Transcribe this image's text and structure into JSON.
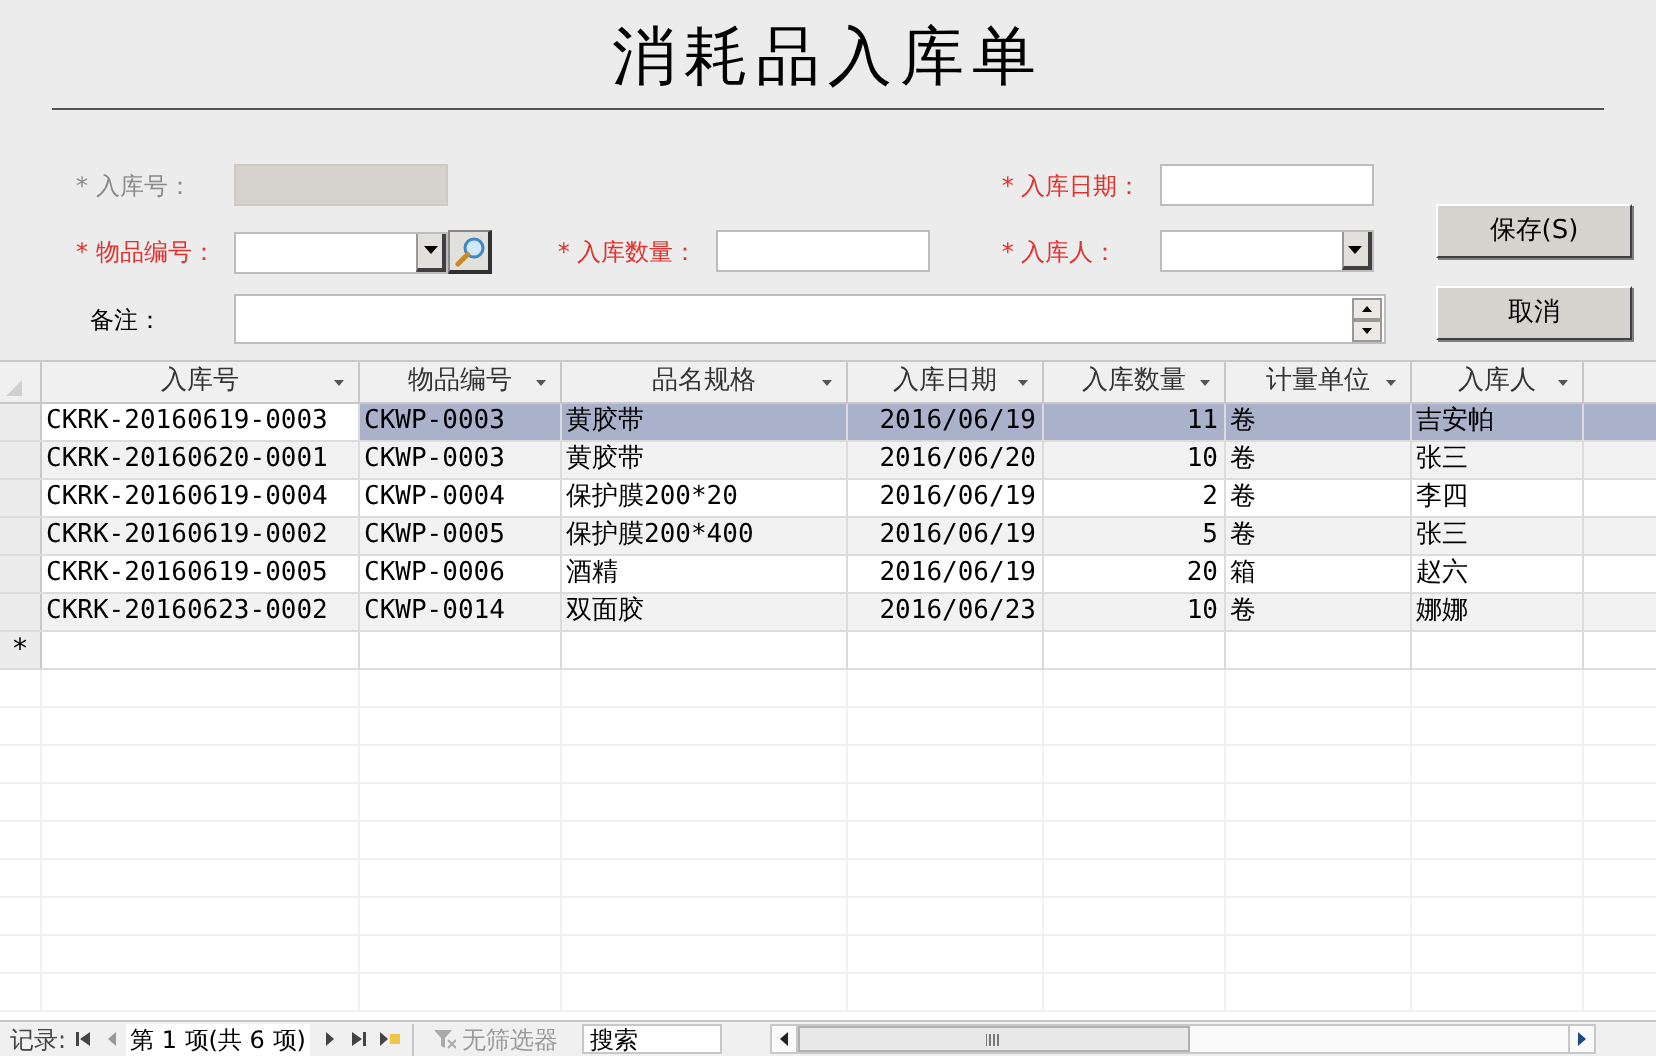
{
  "title": "消耗品入库单",
  "form": {
    "rows": [
      [
        {
          "label": "* 入库号：",
          "kind": "text",
          "disabled": true
        },
        "",
        {
          "label": "* 入库日期：",
          "kind": "text",
          "required": true,
          "disabled": false
        }
      ],
      [
        {
          "label": "* 物品编号：",
          "kind": "lookup",
          "required": true,
          "disabled": false
        },
        {
          "label": "* 入库数量：",
          "kind": "text",
          "required": true,
          "disabled": false
        },
        {
          "label": "* 入库人：",
          "kind": "combo",
          "required": true,
          "disabled": false
        }
      ],
      [
        {
          "label": "备注：",
          "kind": "memo",
          "required": false,
          "disabled": false
        }
      ]
    ]
  },
  "buttons": [
    "保存(S)",
    "取消"
  ],
  "table": {
    "columns": [
      {
        "label": "入库号",
        "kind": "text"
      },
      {
        "label": "物品编号",
        "kind": "text"
      },
      {
        "label": "品名规格",
        "kind": "text"
      },
      {
        "label": "入库日期",
        "kind": "number"
      },
      {
        "label": "入库数量",
        "kind": "number"
      },
      {
        "label": "计量单位",
        "kind": "text"
      },
      {
        "label": "入库人",
        "kind": "text"
      }
    ],
    "rows": [
      {
        "selected": true,
        "cells": [
          "CKRK-20160619-0003",
          "CKWP-0003",
          "黄胶带",
          "2016/06/19",
          "11",
          "卷",
          "吉安帕"
        ]
      },
      {
        "selected": false,
        "cells": [
          "CKRK-20160620-0001",
          "CKWP-0003",
          "黄胶带",
          "2016/06/20",
          "10",
          "卷",
          "张三"
        ]
      },
      {
        "selected": false,
        "cells": [
          "CKRK-20160619-0004",
          "CKWP-0004",
          "保护膜200*20",
          "2016/06/19",
          "2",
          "卷",
          "李四"
        ]
      },
      {
        "selected": false,
        "cells": [
          "CKRK-20160619-0002",
          "CKWP-0005",
          "保护膜200*400",
          "2016/06/19",
          "5",
          "卷",
          "张三"
        ]
      },
      {
        "selected": false,
        "cells": [
          "CKRK-20160619-0005",
          "CKWP-0006",
          "酒精",
          "2016/06/19",
          "20",
          "箱",
          "赵六"
        ]
      },
      {
        "selected": false,
        "cells": [
          "CKRK-20160623-0002",
          "CKWP-0014",
          "双面胶",
          "2016/06/23",
          "10",
          "卷",
          "娜娜"
        ]
      }
    ],
    "new_row_marker": "*"
  },
  "status_bar": {
    "label": "记录:",
    "position": "第 1 项(共 6 项)",
    "filter": {
      "label": "无筛选器",
      "disabled": true
    },
    "search": {
      "placeholder": "搜索"
    }
  }
}
